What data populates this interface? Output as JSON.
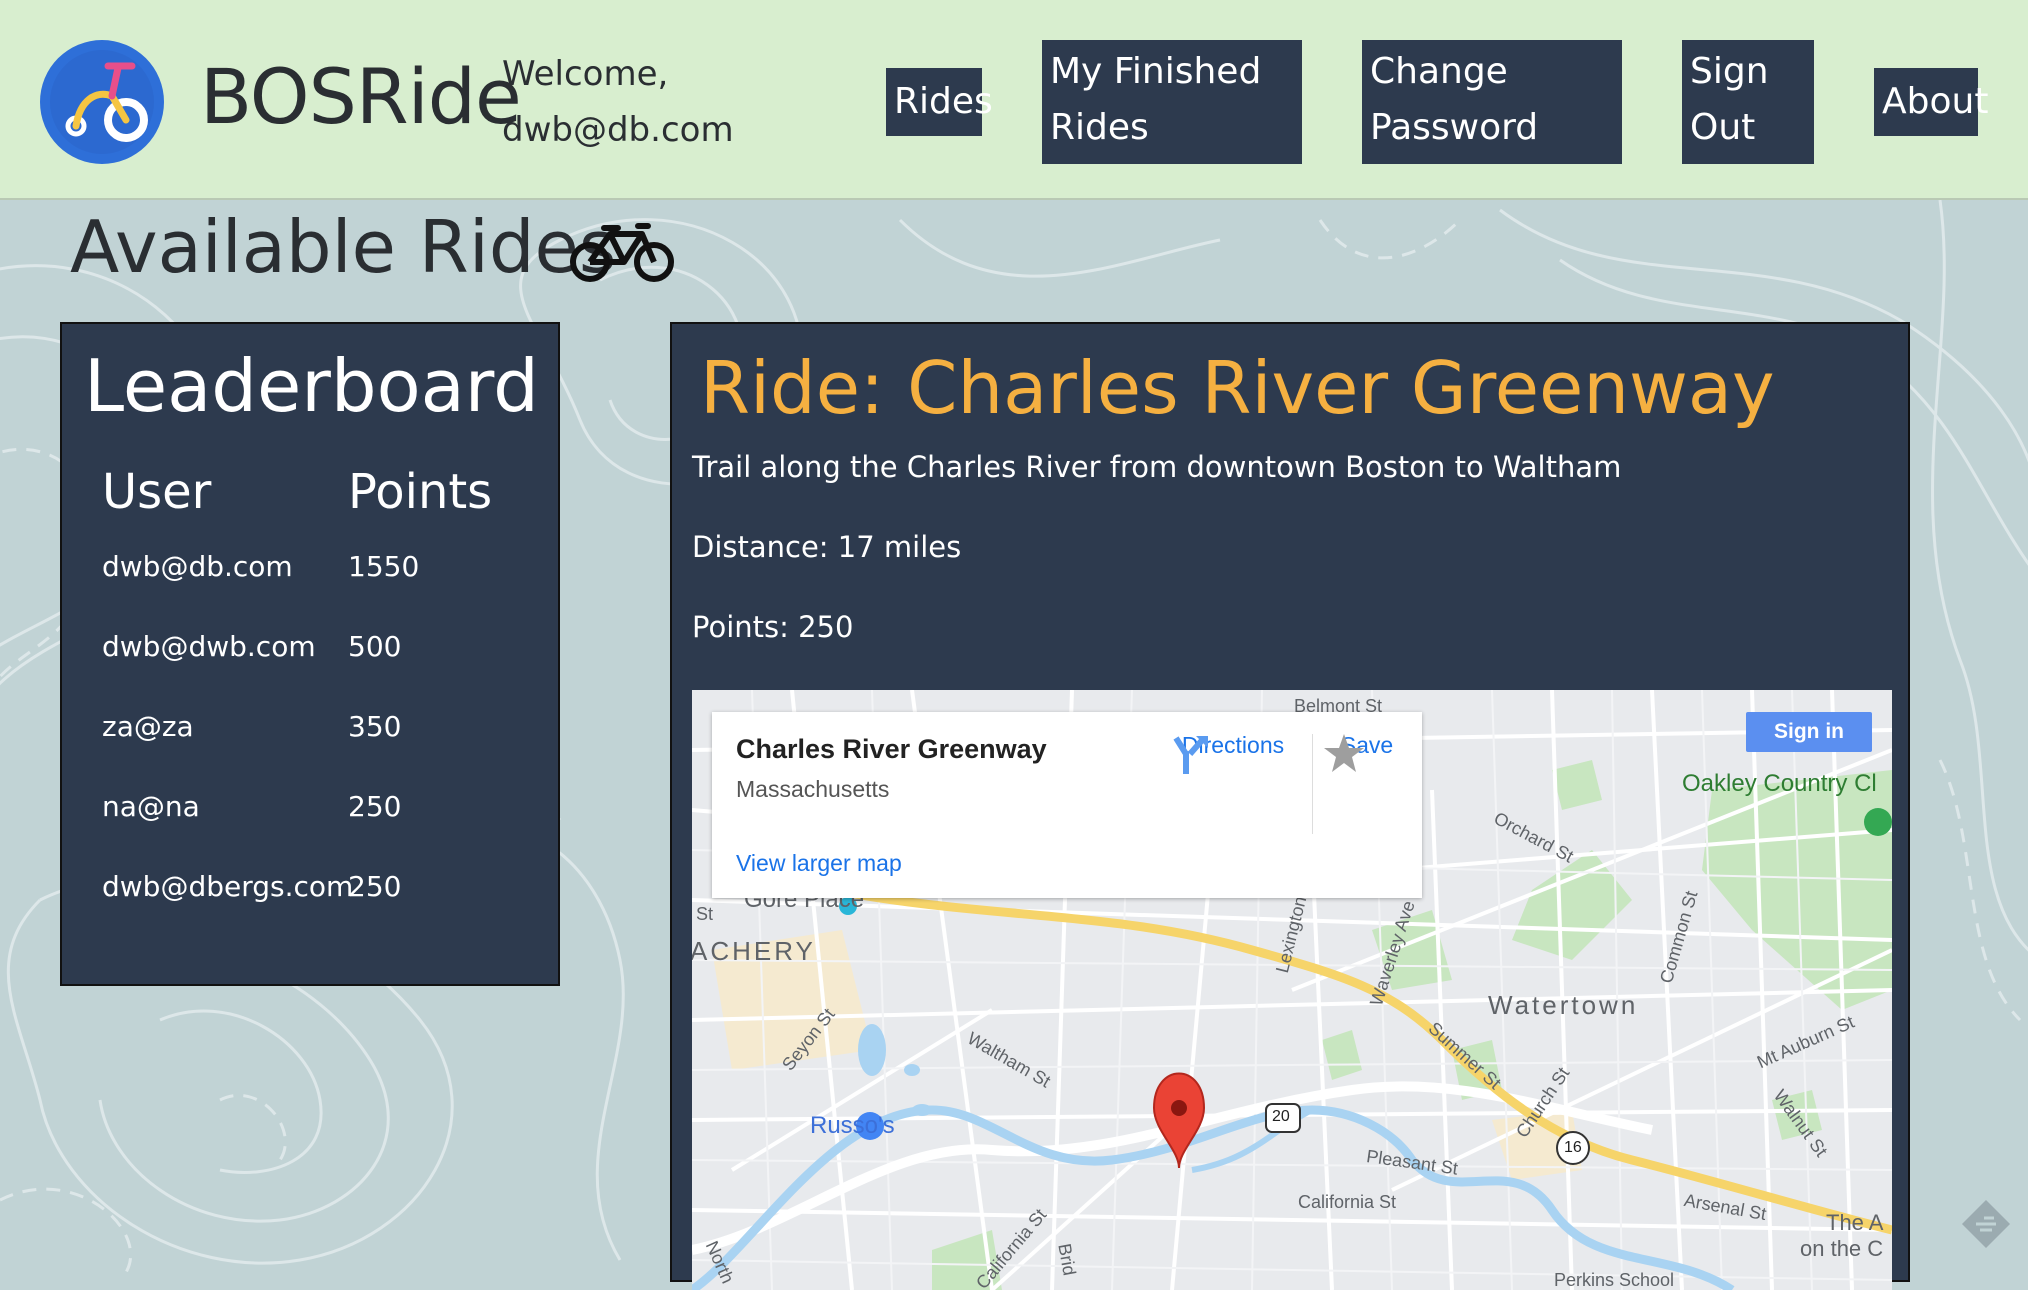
{
  "header": {
    "brand": "BOSRide",
    "welcome_line1": "Welcome,",
    "welcome_line2": "dwb@db.com",
    "nav": {
      "rides": "Rides",
      "finished_line1": "My Finished",
      "finished_line2": "Rides",
      "change_line1": "Change",
      "change_line2": "Password",
      "signout_line1": "Sign",
      "signout_line2": "Out",
      "about": "About"
    }
  },
  "page_title": "Available Rides",
  "leaderboard": {
    "title": "Leaderboard",
    "col_user": "User",
    "col_points": "Points",
    "rows": [
      {
        "user": "dwb@db.com",
        "points": "1550"
      },
      {
        "user": "dwb@dwb.com",
        "points": "500"
      },
      {
        "user": "za@za",
        "points": "350"
      },
      {
        "user": "na@na",
        "points": "250"
      },
      {
        "user": "dwb@dbergs.com",
        "points": "250"
      }
    ]
  },
  "ride": {
    "title": "Ride: Charles River Greenway",
    "description": "Trail along the Charles River from downtown Boston to Waltham",
    "distance": "Distance: 17 miles",
    "points": "Points: 250"
  },
  "map": {
    "card_title": "Charles River Greenway",
    "card_subtitle": "Massachusetts",
    "directions": "Directions",
    "save": "Save",
    "view_larger": "View larger map",
    "sign_in": "Sign in",
    "labels": {
      "belmont": "Belmont St",
      "oakley": "Oakley Country Cl",
      "orchard": "Orchard St",
      "gore": "Gore Place",
      "achery": "ACHERY",
      "lexington": "Lexington",
      "waverley": "Waverley Ave",
      "common": "Common St",
      "watertown": "Watertown",
      "seyon": "Seyon St",
      "waltham": "Waltham St",
      "summer": "Summer St",
      "church": "Church St",
      "mtauburn": "Mt Auburn St",
      "walnut": "Walnut St",
      "russos": "Russo's",
      "pleasant": "Pleasant St",
      "california1": "California St",
      "california2": "California St",
      "arsenal": "Arsenal St",
      "north": "North",
      "brid": "Brid",
      "perkins": "Perkins School",
      "thea": "The A",
      "onthe": "on the C",
      "st": "St",
      "r20": "20",
      "r16": "16"
    }
  },
  "colors": {
    "header_bg": "#d8eecf",
    "panel_bg": "#2d3a4e",
    "ride_title": "#f5b041",
    "page_bg": "#c1d3d5"
  }
}
